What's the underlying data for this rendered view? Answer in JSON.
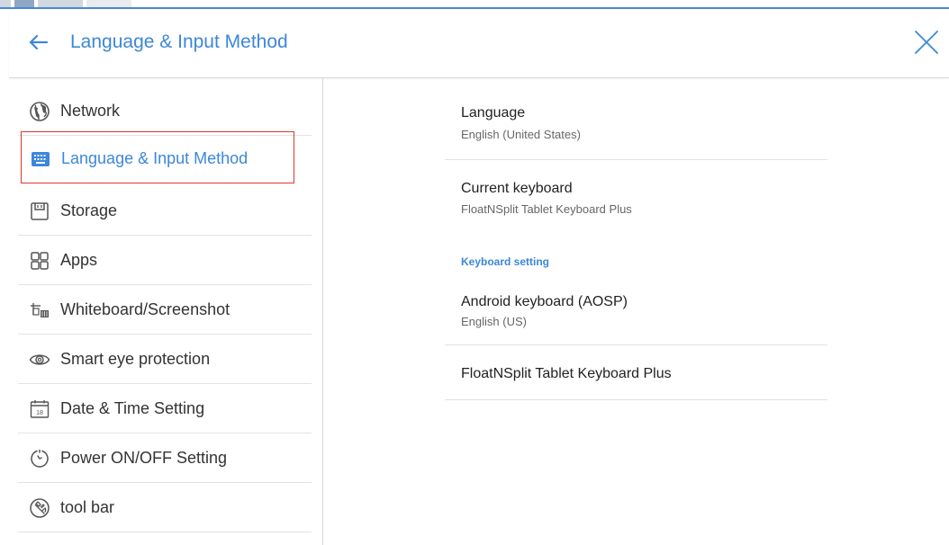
{
  "header": {
    "title": "Language & Input Method",
    "back_icon": "arrow-left-icon",
    "close_icon": "close-icon",
    "accent_color": "#3d87d8"
  },
  "sidebar": {
    "items": [
      {
        "label": "Network",
        "icon": "globe-icon",
        "selected": false
      },
      {
        "label": "Language & Input Method",
        "icon": "keyboard-icon",
        "selected": true
      },
      {
        "label": "Storage",
        "icon": "storage-icon",
        "selected": false
      },
      {
        "label": "Apps",
        "icon": "apps-grid-icon",
        "selected": false
      },
      {
        "label": "Whiteboard/Screenshot",
        "icon": "whiteboard-icon",
        "selected": false
      },
      {
        "label": "Smart eye protection",
        "icon": "eye-icon",
        "selected": false
      },
      {
        "label": "Date & Time Setting",
        "icon": "calendar-icon",
        "selected": false,
        "icon_text": "18"
      },
      {
        "label": "Power ON/OFF Setting",
        "icon": "timer-icon",
        "selected": false
      },
      {
        "label": "tool bar",
        "icon": "toolbar-icon",
        "selected": false
      }
    ],
    "selected_border_color": "#d9362f"
  },
  "content": {
    "language": {
      "title": "Language",
      "value": "English (United States)"
    },
    "current_keyboard": {
      "title": "Current keyboard",
      "value": "FloatNSplit Tablet Keyboard Plus"
    },
    "keyboard_section": {
      "header": "Keyboard setting"
    },
    "keyboards": [
      {
        "title": "Android keyboard (AOSP)",
        "value": "English (US)"
      },
      {
        "title": "FloatNSplit Tablet Keyboard Plus",
        "value": ""
      }
    ]
  }
}
